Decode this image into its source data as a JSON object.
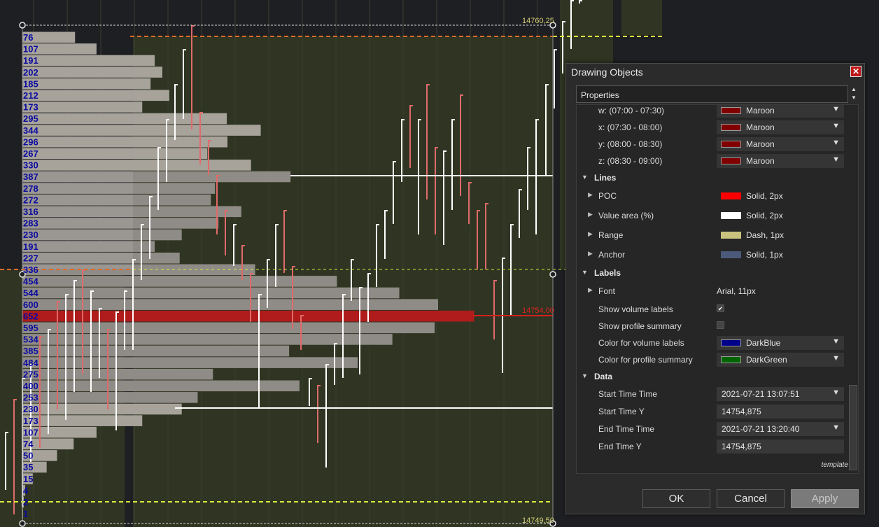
{
  "chart": {
    "price_high_tag": "14760,25",
    "price_low_tag": "14749,50",
    "poc_price_tag": "14754,00",
    "volume_labels": [
      "76",
      "107",
      "191",
      "202",
      "185",
      "212",
      "173",
      "295",
      "344",
      "296",
      "267",
      "330",
      "387",
      "278",
      "272",
      "316",
      "283",
      "230",
      "191",
      "227",
      "336",
      "454",
      "544",
      "600",
      "652",
      "595",
      "534",
      "385",
      "484",
      "275",
      "400",
      "253",
      "230",
      "173",
      "107",
      "74",
      "50",
      "35",
      "15",
      "4",
      "2",
      "1"
    ],
    "colors": {
      "background": "#1e1f22",
      "session_fill": "#2f3522",
      "profile_bar": "#a7a39b",
      "value_area_bar": "#8f8b86",
      "poc_bar": "#b01c1c",
      "volume_label": "#0a0aa0",
      "up_candle": "#ffffff",
      "down_candle": "#e06a6a",
      "range_line": "#e06a2a",
      "anchor_line": "#d8e840"
    }
  },
  "dialog": {
    "title": "Drawing Objects",
    "properties_header": "Properties",
    "rows": {
      "w_label": "w: (07:00 - 07:30)",
      "w_color": "Maroon",
      "x_label": "x: (07:30 - 08:00)",
      "x_color": "Maroon",
      "y_label": "y: (08:00 - 08:30)",
      "y_color": "Maroon",
      "z_label": "z: (08:30 - 09:00)",
      "z_color": "Maroon"
    },
    "lines_category": "Lines",
    "lines": {
      "poc_label": "POC",
      "poc_value": "Solid, 2px",
      "va_label": "Value area (%)",
      "va_value": "Solid, 2px",
      "range_label": "Range",
      "range_value": "Dash, 1px",
      "anchor_label": "Anchor",
      "anchor_value": "Solid, 1px"
    },
    "labels_category": "Labels",
    "labels": {
      "font_label": "Font",
      "font_value": "Arial, 11px",
      "show_volume_label": "Show volume labels",
      "show_volume_checked": "✔",
      "show_summary_label": "Show profile summary",
      "vol_color_label": "Color for volume labels",
      "vol_color_value": "DarkBlue",
      "summary_color_label": "Color for profile summary",
      "summary_color_value": "DarkGreen"
    },
    "data_category": "Data",
    "data": {
      "start_time_label": "Start Time Time",
      "start_time_value": "2021-07-21 13:07:51",
      "start_y_label": "Start Time Y",
      "start_y_value": "14754,875",
      "end_time_label": "End Time Time",
      "end_time_value": "2021-07-21 13:20:40",
      "end_y_label": "End Time Y",
      "end_y_value": "14754,875"
    },
    "template_link": "template",
    "buttons": {
      "ok": "OK",
      "cancel": "Cancel",
      "apply": "Apply"
    }
  }
}
